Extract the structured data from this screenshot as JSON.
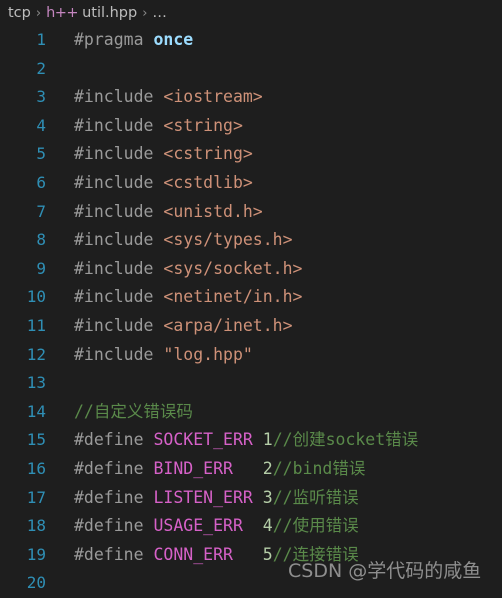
{
  "breadcrumb": {
    "root": "tcp",
    "separator": "›",
    "file_icon_label": "h++",
    "file_name": "util.hpp",
    "overflow": "…"
  },
  "editor": {
    "language": "cpp",
    "colors": {
      "background": "#1e1e1e",
      "line_number": "#2f8fb5",
      "default_text": "#9a9a9a",
      "keyword": "#9cdcfe",
      "string": "#ce9178",
      "macro_name": "#d661c8",
      "number": "#b5cea8",
      "comment": "#5a8a4a",
      "breadcrumb_text": "#bdbdbd",
      "file_icon": "#c586c0"
    },
    "lines": [
      {
        "n": "1",
        "tokens": [
          {
            "t": "pre",
            "v": "#pragma "
          },
          {
            "t": "kw",
            "v": "once"
          }
        ]
      },
      {
        "n": "2",
        "tokens": []
      },
      {
        "n": "3",
        "tokens": [
          {
            "t": "pre",
            "v": "#include "
          },
          {
            "t": "str",
            "v": "<iostream>"
          }
        ]
      },
      {
        "n": "4",
        "tokens": [
          {
            "t": "pre",
            "v": "#include "
          },
          {
            "t": "str",
            "v": "<string>"
          }
        ]
      },
      {
        "n": "5",
        "tokens": [
          {
            "t": "pre",
            "v": "#include "
          },
          {
            "t": "str",
            "v": "<cstring>"
          }
        ]
      },
      {
        "n": "6",
        "tokens": [
          {
            "t": "pre",
            "v": "#include "
          },
          {
            "t": "str",
            "v": "<cstdlib>"
          }
        ]
      },
      {
        "n": "7",
        "tokens": [
          {
            "t": "pre",
            "v": "#include "
          },
          {
            "t": "str",
            "v": "<unistd.h>"
          }
        ]
      },
      {
        "n": "8",
        "tokens": [
          {
            "t": "pre",
            "v": "#include "
          },
          {
            "t": "str",
            "v": "<sys/types.h>"
          }
        ]
      },
      {
        "n": "9",
        "tokens": [
          {
            "t": "pre",
            "v": "#include "
          },
          {
            "t": "str",
            "v": "<sys/socket.h>"
          }
        ]
      },
      {
        "n": "10",
        "tokens": [
          {
            "t": "pre",
            "v": "#include "
          },
          {
            "t": "str",
            "v": "<netinet/in.h>"
          }
        ]
      },
      {
        "n": "11",
        "tokens": [
          {
            "t": "pre",
            "v": "#include "
          },
          {
            "t": "str",
            "v": "<arpa/inet.h>"
          }
        ]
      },
      {
        "n": "12",
        "tokens": [
          {
            "t": "pre",
            "v": "#include "
          },
          {
            "t": "str",
            "v": "\"log.hpp\""
          }
        ]
      },
      {
        "n": "13",
        "tokens": []
      },
      {
        "n": "14",
        "tokens": [
          {
            "t": "cmt",
            "v": "//自定义错误码"
          }
        ]
      },
      {
        "n": "15",
        "tokens": [
          {
            "t": "pre",
            "v": "#define "
          },
          {
            "t": "macro",
            "v": "SOCKET_ERR"
          },
          {
            "t": "pre",
            "v": " "
          },
          {
            "t": "num",
            "v": "1"
          },
          {
            "t": "cmt",
            "v": "//创建socket错误"
          }
        ]
      },
      {
        "n": "16",
        "tokens": [
          {
            "t": "pre",
            "v": "#define "
          },
          {
            "t": "macro",
            "v": "BIND_ERR"
          },
          {
            "t": "pre",
            "v": "   "
          },
          {
            "t": "num",
            "v": "2"
          },
          {
            "t": "cmt",
            "v": "//bind错误"
          }
        ]
      },
      {
        "n": "17",
        "tokens": [
          {
            "t": "pre",
            "v": "#define "
          },
          {
            "t": "macro",
            "v": "LISTEN_ERR"
          },
          {
            "t": "pre",
            "v": " "
          },
          {
            "t": "num",
            "v": "3"
          },
          {
            "t": "cmt",
            "v": "//监听错误"
          }
        ]
      },
      {
        "n": "18",
        "tokens": [
          {
            "t": "pre",
            "v": "#define "
          },
          {
            "t": "macro",
            "v": "USAGE_ERR"
          },
          {
            "t": "pre",
            "v": "  "
          },
          {
            "t": "num",
            "v": "4"
          },
          {
            "t": "cmt",
            "v": "//使用错误"
          }
        ]
      },
      {
        "n": "19",
        "tokens": [
          {
            "t": "pre",
            "v": "#define "
          },
          {
            "t": "macro",
            "v": "CONN_ERR"
          },
          {
            "t": "pre",
            "v": "   "
          },
          {
            "t": "num",
            "v": "5"
          },
          {
            "t": "cmt",
            "v": "//连接错误"
          }
        ]
      },
      {
        "n": "20",
        "tokens": []
      }
    ]
  },
  "watermark": {
    "text": "CSDN @学代码的咸鱼"
  }
}
